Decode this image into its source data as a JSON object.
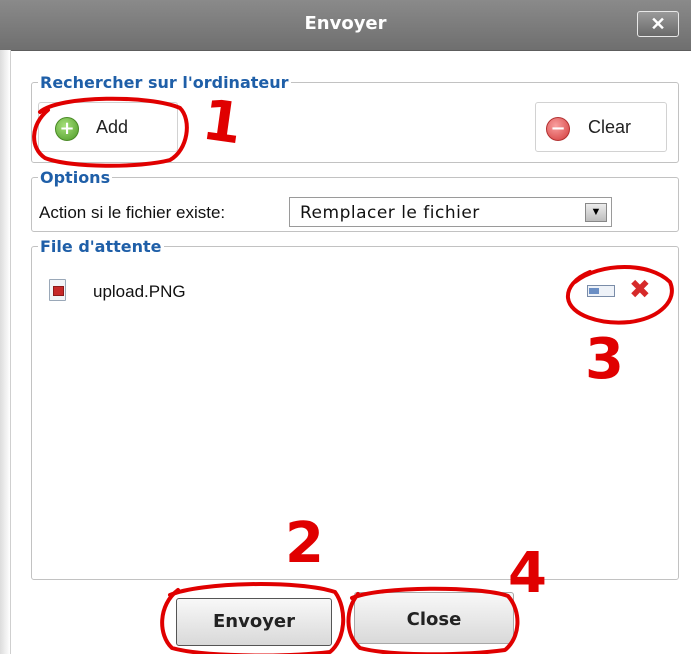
{
  "dialog": {
    "title": "Envoyer",
    "close_glyph": "✕"
  },
  "browse": {
    "legend": "Rechercher sur l'ordinateur",
    "add_label": "Add",
    "clear_label": "Clear",
    "add_icon": "plus-circle-icon",
    "clear_icon": "minus-circle-icon"
  },
  "options": {
    "legend": "Options",
    "label": "Action si le fichier existe:",
    "selected": "Remplacer le fichier"
  },
  "queue": {
    "legend": "File d'attente",
    "items": [
      {
        "name": "upload.PNG",
        "progress": 0.4
      }
    ]
  },
  "footer": {
    "send_label": "Envoyer",
    "close_label": "Close"
  },
  "annotations": {
    "numbers": [
      "1",
      "2",
      "3",
      "4"
    ],
    "color": "#e00000"
  }
}
